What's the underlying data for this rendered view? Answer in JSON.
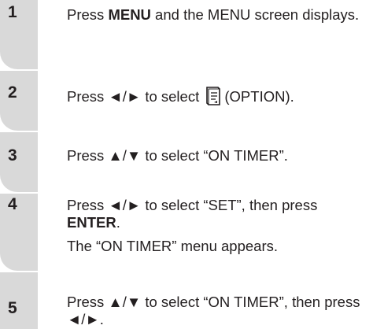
{
  "steps": [
    {
      "number": "1",
      "t1": "Press ",
      "b1": "MENU",
      "t2": " and the MENU screen displays."
    },
    {
      "number": "2",
      "t1": "Press ◄/► to select ",
      "icon": "option-menu-icon",
      "t2": "(OPTION)."
    },
    {
      "number": "3",
      "t1": "Press ▲/▼ to select “ON TIMER”."
    },
    {
      "number": "4",
      "t1": "Press ◄/► to select “SET”, then press ",
      "b1": "ENTER",
      "t2": ".",
      "sub": "The “ON TIMER” menu appears."
    },
    {
      "number": "5",
      "t1": "Press ▲/▼ to select “ON TIMER”, then press ◄/►."
    }
  ],
  "colors": {
    "text": "#231f20",
    "number_tab": "#d9d9d9"
  }
}
